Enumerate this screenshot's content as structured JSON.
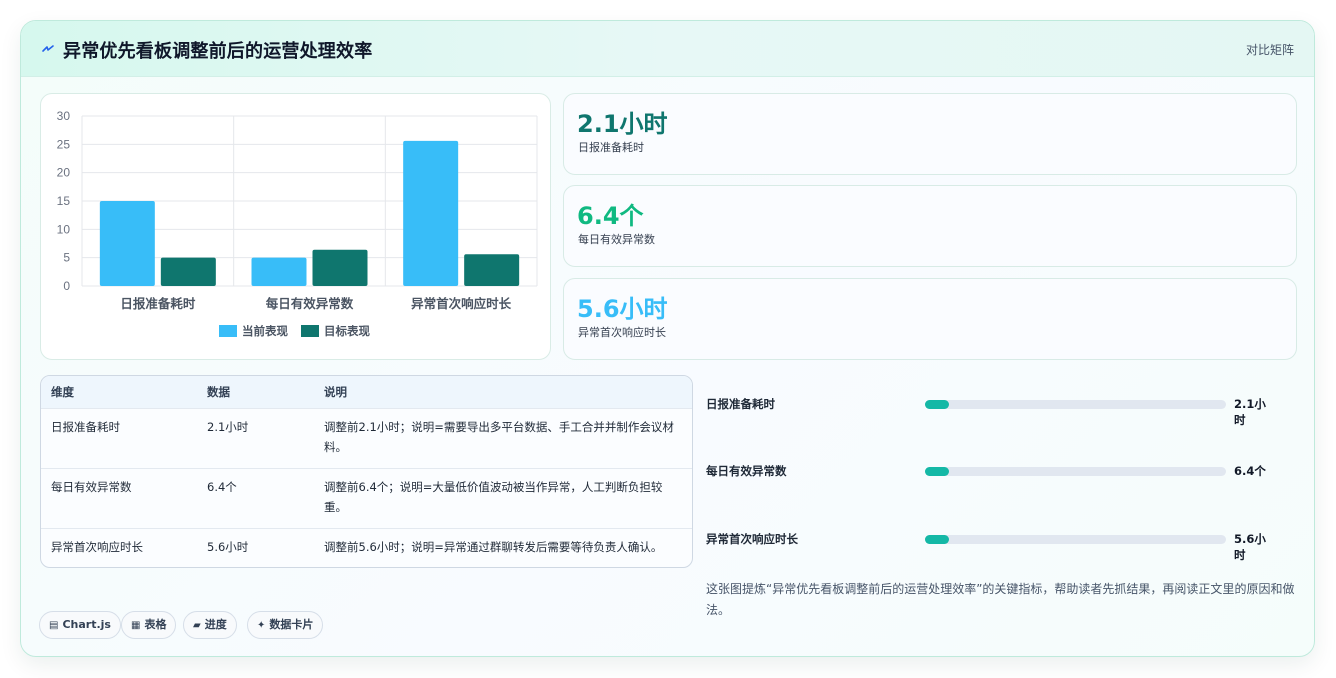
{
  "header": {
    "title": "异常优先看板调整前后的运营处理效率",
    "right_link": "对比矩阵",
    "accent": "#2563eb"
  },
  "chart_data": {
    "type": "bar",
    "categories": [
      "日报准备耗时",
      "每日有效异常数",
      "异常首次响应时长"
    ],
    "series": [
      {
        "name": "当前表现",
        "values": [
          15,
          5,
          25.6
        ],
        "color": "#38bdf8"
      },
      {
        "name": "目标表现",
        "values": [
          5,
          6.4,
          5.6
        ],
        "color": "#0f766e"
      }
    ],
    "ylim": [
      0,
      30
    ],
    "yticks": [
      0,
      5,
      10,
      15,
      20,
      25,
      30
    ],
    "grid": true,
    "legend": "bottom"
  },
  "kpis": [
    {
      "value": "2.1小时",
      "label": "日报准备耗时",
      "color": "#0f766e"
    },
    {
      "value": "6.4个",
      "label": "每日有效异常数",
      "color": "#10b981"
    },
    {
      "value": "5.6小时",
      "label": "异常首次响应时长",
      "color": "#38bdf8"
    }
  ],
  "table": {
    "headers": [
      "维度",
      "数据",
      "说明"
    ],
    "rows": [
      {
        "dim": "日报准备耗时",
        "data": "2.1小时",
        "note": "调整前2.1小时；说明=需要导出多平台数据、手工合并并制作会议材料。"
      },
      {
        "dim": "每日有效异常数",
        "data": "6.4个",
        "note": "调整前6.4个；说明=大量低价值波动被当作异常，人工判断负担较重。"
      },
      {
        "dim": "异常首次响应时长",
        "data": "5.6小时",
        "note": "调整前5.6小时；说明=异常通过群聊转发后需要等待负责人确认。"
      }
    ]
  },
  "progress": [
    {
      "label": "日报准备耗时",
      "value": "2.1小时",
      "fraction": 0.08
    },
    {
      "label": "每日有效异常数",
      "value": "6.4个",
      "fraction": 0.08
    },
    {
      "label": "异常首次响应时长",
      "value": "5.6小时",
      "fraction": 0.08
    }
  ],
  "summary": "这张图提炼“异常优先看板调整前后的运营处理效率”的关键指标，帮助读者先抓结果，再阅读正文里的原因和做法。",
  "tags": [
    {
      "icon": "chart-icon",
      "glyph": "▤",
      "label": "Chart.js"
    },
    {
      "icon": "table-icon",
      "glyph": "▦",
      "label": "表格"
    },
    {
      "icon": "progress-icon",
      "glyph": "▰",
      "label": "进度"
    },
    {
      "icon": "card-icon",
      "glyph": "✦",
      "label": "数据卡片"
    }
  ]
}
